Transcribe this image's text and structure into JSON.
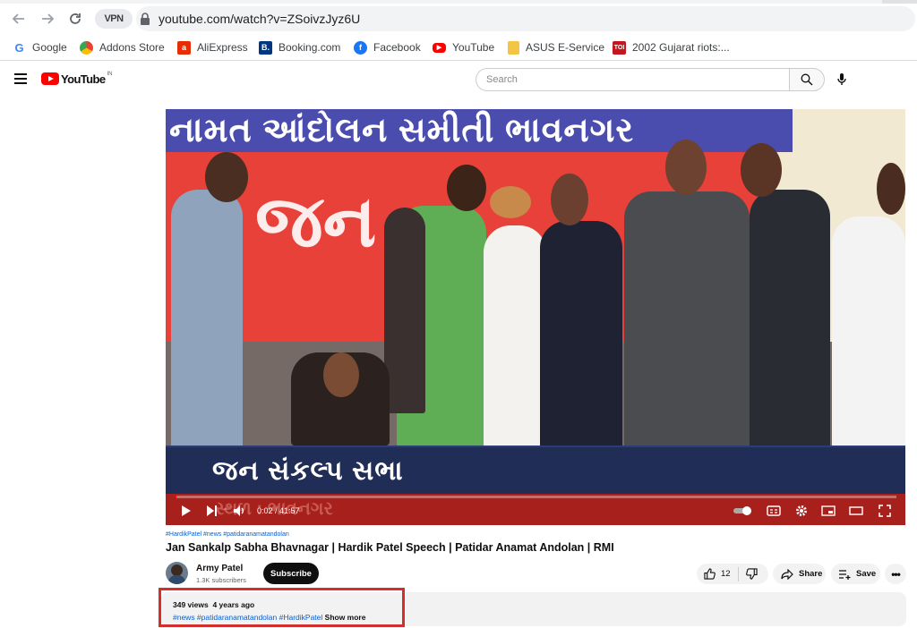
{
  "browser": {
    "url": "youtube.com/watch?v=ZSoivzJyz6U",
    "vpn_label": "VPN",
    "bookmarks": [
      {
        "label": "Google",
        "icon": "google-icon",
        "color": "#4285f4"
      },
      {
        "label": "Addons Store",
        "icon": "addons-store-icon",
        "color": "#e94235"
      },
      {
        "label": "AliExpress",
        "icon": "aliexpress-icon",
        "color": "#e62e04"
      },
      {
        "label": "Booking.com",
        "icon": "booking-icon",
        "color": "#003580"
      },
      {
        "label": "Facebook",
        "icon": "facebook-icon",
        "color": "#1877f2"
      },
      {
        "label": "YouTube",
        "icon": "youtube-icon",
        "color": "#ff0000"
      },
      {
        "label": "ASUS E-Service",
        "icon": "folder-icon",
        "color": "#f4c542"
      },
      {
        "label": "2002 Gujarat riots:...",
        "icon": "toi-icon",
        "color": "#c4161c"
      }
    ]
  },
  "youtube": {
    "logo_text": "YouTube",
    "country_code": "IN",
    "search_placeholder": "Search"
  },
  "video": {
    "banner_text": "નામત આંદોલન સમીતી ભાવનગર",
    "lower_third_text": "જન સંકલ્પ સભા",
    "ghost_caption": "સ્થળ : ભાવનગર",
    "current_time": "0:02",
    "duration": "41:57",
    "time_display": "0:02 / 41:57",
    "progress_fraction": 0.001
  },
  "meta": {
    "hashtags_top": "#HardikPatel #news #patidaranamatandolan",
    "title": "Jan Sankalp Sabha Bhavnagar | Hardik Patel Speech | Patidar Anamat Andolan | RMI",
    "channel_name": "Army Patel",
    "subscribers": "1.3K subscribers",
    "subscribe_label": "Subscribe",
    "like_count": "12",
    "share_label": "Share",
    "save_label": "Save",
    "views": "349 views",
    "age": "4 years ago",
    "desc_tags": "#news #patidaranamatandolan #HardikPatel",
    "show_more_label": "Show more"
  }
}
